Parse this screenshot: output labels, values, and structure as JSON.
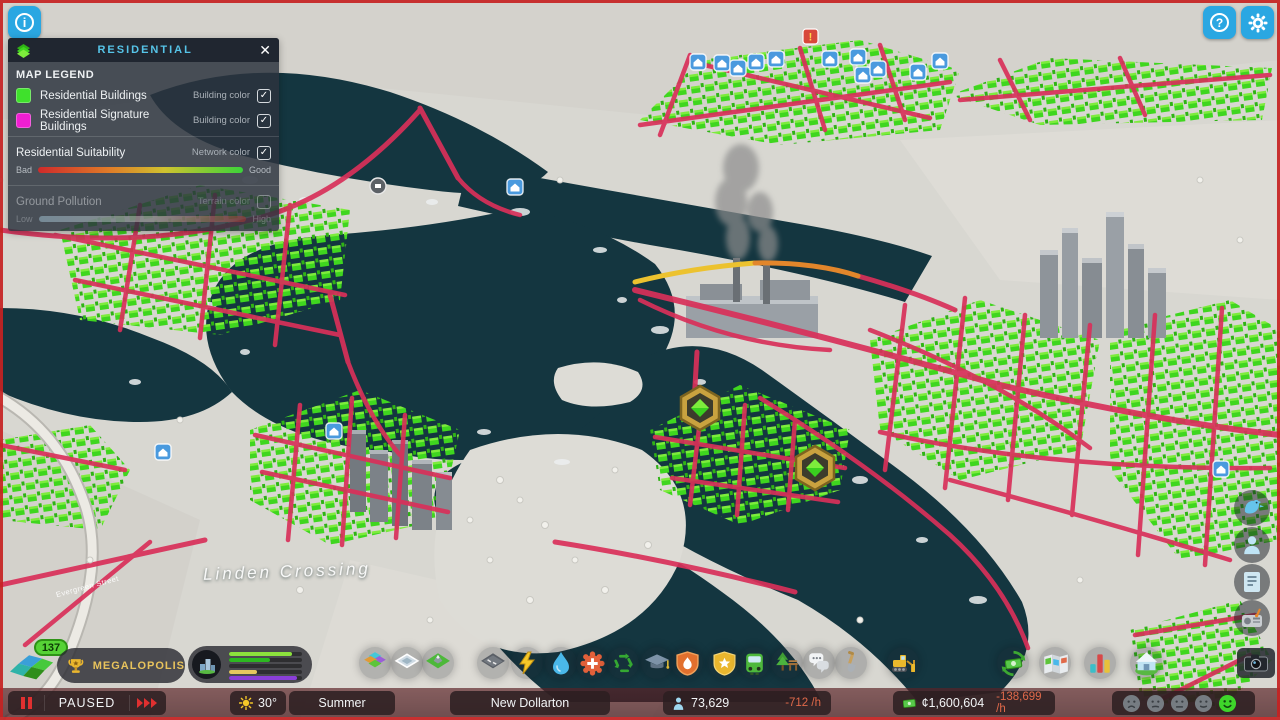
{
  "hud": {
    "info_button_glyph": "i",
    "help_button_glyph": "?"
  },
  "legend": {
    "title": "RESIDENTIAL",
    "section": "MAP LEGEND",
    "rows": [
      {
        "label": "Residential Buildings",
        "meta": "Building color",
        "check": "✓",
        "swatch": "#3fe12c"
      },
      {
        "label": "Residential Signature Buildings",
        "meta": "Building color",
        "check": "✓",
        "swatch": "#f01ed2"
      },
      {
        "label": "Residential Suitability",
        "meta": "Network color",
        "check": "✓",
        "scale": {
          "min": "Bad",
          "max": "Good",
          "colors": [
            "#cf2a2a",
            "#e07c28",
            "#cfc32f",
            "#3bd339"
          ]
        }
      },
      {
        "label": "Ground Pollution",
        "meta": "Terrain color",
        "check": "",
        "scale": {
          "min": "Low",
          "max": "High",
          "colors": [
            "#aed3e6",
            "#ded8cc",
            "#b5372c"
          ]
        }
      }
    ]
  },
  "map": {
    "district_label": "Linden Crossing",
    "street_label": "Evergreen Street"
  },
  "progression": {
    "level": "137",
    "milestone": "MEGALOPOLIS"
  },
  "demand": {
    "bars": [
      {
        "name": "residential-low",
        "color": "#8ce23d",
        "pct": 86
      },
      {
        "name": "residential-high",
        "color": "#2db821",
        "pct": 56
      },
      {
        "name": "commercial",
        "color": "#4a5156",
        "pct": 0
      },
      {
        "name": "industrial",
        "color": "#e5c75f",
        "pct": 38
      },
      {
        "name": "office",
        "color": "#8a3fd8",
        "pct": 93
      }
    ]
  },
  "toolbar": {
    "icons": [
      "zoning",
      "districts",
      "terraforming",
      "roads",
      "electricity",
      "water",
      "healthcare",
      "garbage",
      "education",
      "fire-rescue",
      "police",
      "transportation",
      "parks-recreation",
      "communications",
      "landscaping",
      "bulldozer",
      "economy",
      "progression",
      "statistics",
      "info-views",
      "photo-mode"
    ]
  },
  "side_buttons": [
    "chirper",
    "citizens",
    "journal",
    "radio"
  ],
  "statusbar": {
    "sim_state": "PAUSED",
    "temperature": "30°",
    "season": "Summer",
    "city_name": "New Dollarton",
    "population": "73,629",
    "population_rate": "-712 /h",
    "money": "¢1,600,604",
    "money_rate": "-138,699 /h",
    "happiness_faces": 5,
    "happiness_active_index": 4
  },
  "colors": {
    "accent_blue": "#2aa7e2",
    "legend_title_cyan": "#56c4e8",
    "milestone_gold": "#e8c35c",
    "negative_rate": "#e0694a",
    "road_red": "#d9305a",
    "road_warning_yellow": "#ecc22f",
    "road_warning_orange": "#e2862b",
    "water_teal": "#143640",
    "residential_green": "#3fd61f",
    "signature_magenta": "#f01ed2",
    "snow": "#d8d7d1"
  }
}
